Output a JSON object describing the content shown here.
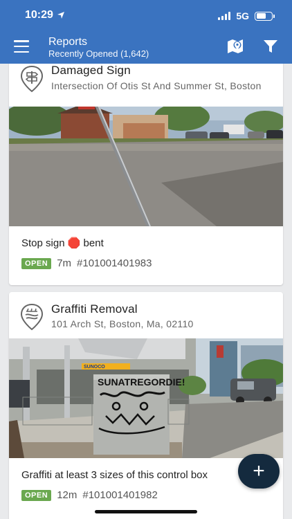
{
  "status_bar": {
    "time": "10:29",
    "network": "5G"
  },
  "header": {
    "title": "Reports",
    "subtitle": "Recently Opened (1,642)",
    "icons": [
      "menu-icon",
      "map-icon",
      "filter-icon"
    ]
  },
  "reports": [
    {
      "title": "Damaged Sign",
      "address": "Intersection Of Otis St And Summer St, Boston",
      "description": "Stop sign 🛑 bent",
      "status": "OPEN",
      "age": "7m",
      "id": "#101001401983"
    },
    {
      "title": "Graffiti Removal",
      "address": "101 Arch St, Boston, Ma, 02110",
      "description": "Graffiti at least 3 sizes of this control box",
      "status": "OPEN",
      "age": "12m",
      "id": "#101001401982"
    }
  ],
  "photo_text": {
    "graffiti_tag": "SUNATREGORDIE!",
    "station_sign": "SUNOCO"
  },
  "fab": {
    "label": "+"
  },
  "colors": {
    "header": "#3a73c0",
    "badge": "#6aa84f",
    "fab": "#142a3e"
  }
}
